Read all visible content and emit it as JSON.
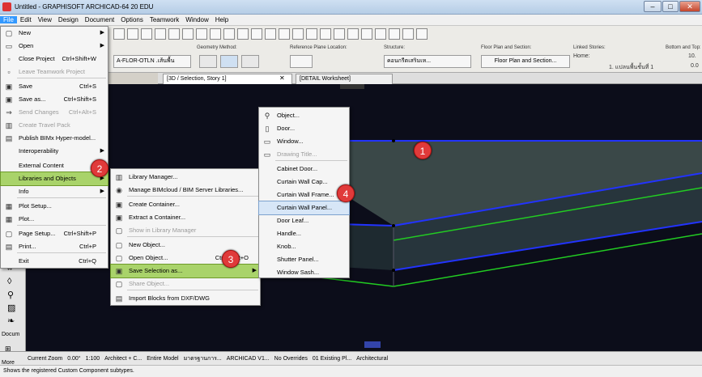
{
  "window": {
    "title": "Untitled - GRAPHISOFT ARCHICAD-64 20 EDU",
    "controls": [
      "–",
      "□",
      "✕"
    ]
  },
  "menubar": [
    "File",
    "Edit",
    "View",
    "Design",
    "Document",
    "Options",
    "Teamwork",
    "Window",
    "Help"
  ],
  "toolbar": {
    "geometry_label": "Geometry Method:",
    "ref_plane_label": "Reference Plane Location:",
    "structure_label": "Structure:",
    "floorplan_label": "Floor Plan and Section:",
    "linked_label": "Linked Stories:",
    "bottom_label": "Bottom and Top:",
    "layer_value": "A-FLOR-OTLN .เส้นพื้น",
    "structure_value": "คอนกรีตเสริมเห...",
    "floorplan_value": "Floor Plan and Section...",
    "home_label": "Home:",
    "home_value": "1. แปลนพื้นชั้นที่ 1",
    "bottom_value1": "10.",
    "bottom_value2": "0.0"
  },
  "tabs": [
    {
      "label": "[3D / Selection, Story 1]"
    },
    {
      "label": "[DETAIL Worksheet]"
    }
  ],
  "file_menu": {
    "items": [
      {
        "label": "New",
        "shortcut": "",
        "arrow": true,
        "disabled": false,
        "icon": "new-file-icon",
        "glyph": "▢"
      },
      {
        "label": "Open",
        "shortcut": "",
        "arrow": true,
        "disabled": false,
        "icon": "open-folder-icon",
        "glyph": "▭"
      },
      {
        "label": "Close Project",
        "shortcut": "Ctrl+Shift+W",
        "arrow": false,
        "disabled": false,
        "icon": "close-project-icon",
        "glyph": "▫"
      },
      {
        "label": "Leave Teamwork Project",
        "shortcut": "",
        "arrow": false,
        "disabled": true,
        "icon": "leave-teamwork-icon",
        "glyph": "▫"
      },
      {
        "label": "Save",
        "shortcut": "Ctrl+S",
        "arrow": false,
        "disabled": false,
        "icon": "save-icon",
        "glyph": "▣"
      },
      {
        "label": "Save as...",
        "shortcut": "Ctrl+Shift+S",
        "arrow": false,
        "disabled": false,
        "icon": "save-as-icon",
        "glyph": "▣"
      },
      {
        "label": "Send Changes",
        "shortcut": "Ctrl+Alt+S",
        "arrow": false,
        "disabled": true,
        "icon": "send-changes-icon",
        "glyph": "⇒"
      },
      {
        "label": "Create Travel Pack",
        "shortcut": "",
        "arrow": false,
        "disabled": true,
        "icon": "travel-pack-icon",
        "glyph": "▥"
      },
      {
        "label": "Publish BIMx Hyper-model...",
        "shortcut": "",
        "arrow": false,
        "disabled": false,
        "icon": "bimx-icon",
        "glyph": "▤"
      },
      {
        "label": "Interoperability",
        "shortcut": "",
        "arrow": true,
        "disabled": false,
        "icon": "",
        "glyph": ""
      },
      {
        "label": "External Content",
        "shortcut": "",
        "arrow": true,
        "disabled": false,
        "icon": "",
        "glyph": ""
      },
      {
        "label": "Libraries and Objects",
        "shortcut": "",
        "arrow": true,
        "disabled": false,
        "icon": "",
        "glyph": ""
      },
      {
        "label": "Info",
        "shortcut": "",
        "arrow": true,
        "disabled": false,
        "icon": "",
        "glyph": ""
      },
      {
        "label": "Plot Setup...",
        "shortcut": "",
        "arrow": false,
        "disabled": false,
        "icon": "plot-setup-icon",
        "glyph": "▦"
      },
      {
        "label": "Plot...",
        "shortcut": "",
        "arrow": false,
        "disabled": false,
        "icon": "plot-icon",
        "glyph": "▦"
      },
      {
        "label": "Page Setup...",
        "shortcut": "Ctrl+Shift+P",
        "arrow": false,
        "disabled": false,
        "icon": "page-setup-icon",
        "glyph": "▢"
      },
      {
        "label": "Print...",
        "shortcut": "Ctrl+P",
        "arrow": false,
        "disabled": false,
        "icon": "print-icon",
        "glyph": "▤"
      },
      {
        "label": "Exit",
        "shortcut": "Ctrl+Q",
        "arrow": false,
        "disabled": false,
        "icon": "",
        "glyph": ""
      }
    ]
  },
  "libraries_menu": {
    "items": [
      {
        "label": "Library Manager...",
        "disabled": false,
        "arrow": false,
        "icon": "library-manager-icon",
        "glyph": "▥"
      },
      {
        "label": "Manage BIMcloud / BIM Server Libraries...",
        "disabled": false,
        "arrow": false,
        "icon": "bimcloud-icon",
        "glyph": "◉"
      },
      {
        "label": "Create Container...",
        "disabled": false,
        "arrow": false,
        "icon": "create-container-icon",
        "glyph": "▣"
      },
      {
        "label": "Extract a Container...",
        "disabled": false,
        "arrow": false,
        "icon": "extract-container-icon",
        "glyph": "▣"
      },
      {
        "label": "Show in Library Manager",
        "disabled": true,
        "arrow": false,
        "icon": "show-library-icon",
        "glyph": "▢"
      },
      {
        "label": "New Object...",
        "disabled": false,
        "arrow": false,
        "icon": "new-object-icon",
        "glyph": "▢"
      },
      {
        "label": "Open Object...",
        "disabled": false,
        "arrow": false,
        "icon": "open-object-icon",
        "glyph": "▢",
        "shortcut": "Ctrl+Shift+O"
      },
      {
        "label": "Save Selection as...",
        "disabled": false,
        "arrow": true,
        "icon": "save-selection-icon",
        "glyph": "▣"
      },
      {
        "label": "Share Object...",
        "disabled": true,
        "arrow": false,
        "icon": "share-object-icon",
        "glyph": "▢"
      },
      {
        "label": "Import Blocks from DXF/DWG",
        "disabled": false,
        "arrow": false,
        "icon": "import-blocks-icon",
        "glyph": "▤"
      }
    ]
  },
  "save_selection_menu": {
    "items": [
      {
        "label": "Object...",
        "disabled": false,
        "icon": "object-icon",
        "glyph": "⚲"
      },
      {
        "label": "Door...",
        "disabled": false,
        "icon": "door-icon",
        "glyph": "▯"
      },
      {
        "label": "Window...",
        "disabled": false,
        "icon": "window-icon",
        "glyph": "▭"
      },
      {
        "label": "Drawing Title...",
        "disabled": true,
        "icon": "drawing-title-icon",
        "glyph": "▭"
      },
      {
        "label": "Cabinet Door...",
        "disabled": false,
        "icon": "",
        "glyph": ""
      },
      {
        "label": "Curtain Wall Cap...",
        "disabled": false,
        "icon": "",
        "glyph": ""
      },
      {
        "label": "Curtain Wall Frame...",
        "disabled": false,
        "icon": "",
        "glyph": ""
      },
      {
        "label": "Curtain Wall Panel...",
        "disabled": false,
        "icon": "",
        "glyph": ""
      },
      {
        "label": "Door Leaf...",
        "disabled": false,
        "icon": "",
        "glyph": ""
      },
      {
        "label": "Handle...",
        "disabled": false,
        "icon": "",
        "glyph": ""
      },
      {
        "label": "Knob...",
        "disabled": false,
        "icon": "",
        "glyph": ""
      },
      {
        "label": "Shutter Panel...",
        "disabled": false,
        "icon": "",
        "glyph": ""
      },
      {
        "label": "Window Sash...",
        "disabled": false,
        "icon": "",
        "glyph": ""
      }
    ]
  },
  "badges": [
    "1",
    "2",
    "3",
    "4"
  ],
  "bottombar": {
    "zoom": "Current Zoom",
    "angle": "0.00°",
    "scale": "1:100",
    "pen": "Architect + C...",
    "model": "Entire Model",
    "structure": "มาตรฐานการ...",
    "layer": "ARCHICAD V1...",
    "override": "No Overrides",
    "renov": "01 Existing Pl...",
    "view": "Architectural"
  },
  "left_tool_label": "Docum",
  "more_label": "More",
  "status": "Shows the registered Custom Component subtypes.",
  "colors": {
    "viewport_bg": "#0c0d1a",
    "slab_top": "#3a4a4a",
    "edge_blue": "#2233ff",
    "edge_green": "#22cc22",
    "highlight_green": "#a9d36a",
    "badge_red": "#e03a3a"
  }
}
